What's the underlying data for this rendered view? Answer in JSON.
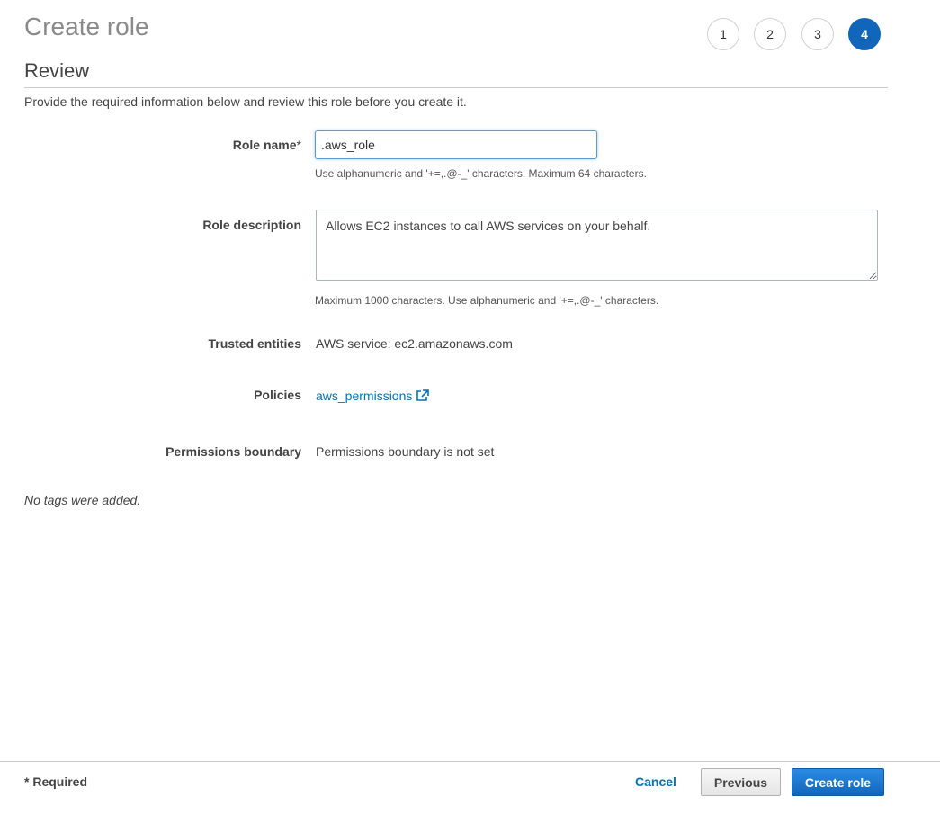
{
  "header": {
    "title": "Create role",
    "steps": [
      "1",
      "2",
      "3",
      "4"
    ],
    "active_step": "4"
  },
  "review": {
    "section_title": "Review",
    "intro": "Provide the required information below and review this role before you create it."
  },
  "fields": {
    "role_name": {
      "label": "Role name",
      "required_marker": "*",
      "value": ".aws_role",
      "hint": "Use alphanumeric and '+=,.@-_' characters. Maximum 64 characters."
    },
    "role_description": {
      "label": "Role description",
      "value": "Allows EC2 instances to call AWS services on your behalf.",
      "hint": "Maximum 1000 characters. Use alphanumeric and '+=,.@-_' characters."
    },
    "trusted_entities": {
      "label": "Trusted entities",
      "value": "AWS service: ec2.amazonaws.com"
    },
    "policies": {
      "label": "Policies",
      "link_text": "aws_permissions",
      "icon": "external-link-icon"
    },
    "permissions_boundary": {
      "label": "Permissions boundary",
      "value": "Permissions boundary is not set"
    }
  },
  "tags_note": "No tags were added.",
  "footer": {
    "required_note": "* Required",
    "cancel_label": "Cancel",
    "previous_label": "Previous",
    "create_label": "Create role"
  },
  "colors": {
    "accent": "#1166bb",
    "link": "#0073bb",
    "primary_button": "#1166bb"
  }
}
